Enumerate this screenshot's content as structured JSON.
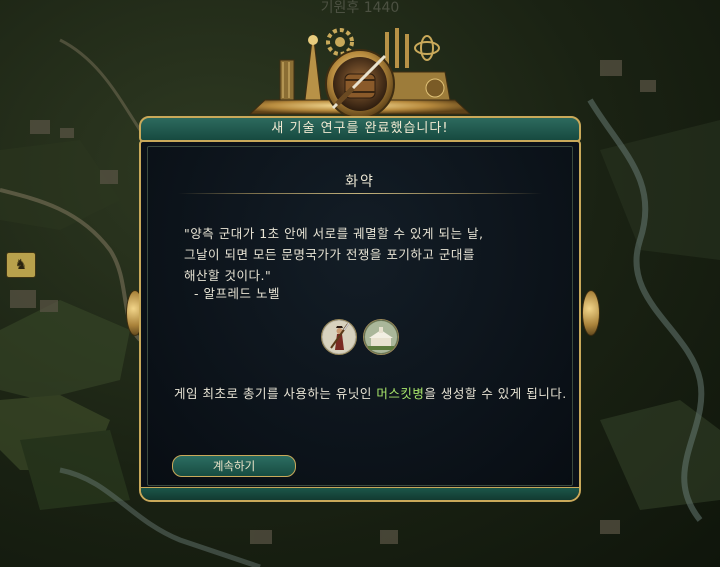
{
  "top_info": {
    "line1": "",
    "line2": "기원후 1440"
  },
  "banner": {
    "label": "새 기술 연구를 완료했습니다!"
  },
  "tech": {
    "name": "화약"
  },
  "quote": {
    "text": "\"양측 군대가 1초 안에 서로를 궤멸할 수 있게 되는 날,\n그날이 되면 모든 문명국가가 전쟁을 포기하고 군대를\n해산할 것이다.\"",
    "author": "- 알프레드 노벨"
  },
  "unlocks": [
    {
      "icon": "musketman-icon"
    },
    {
      "icon": "building-icon"
    }
  ],
  "description": {
    "prefix": "게임 최초로 총기를 사용하는 유닛인 ",
    "highlight": "머스킷병",
    "suffix": "을 생성할 수 있게 됩니다."
  },
  "buttons": {
    "continue": "계속하기"
  },
  "colors": {
    "accent_gold": "#c9a95a",
    "banner_teal": "#2d6a5e",
    "highlight_green": "#a7e46a"
  }
}
